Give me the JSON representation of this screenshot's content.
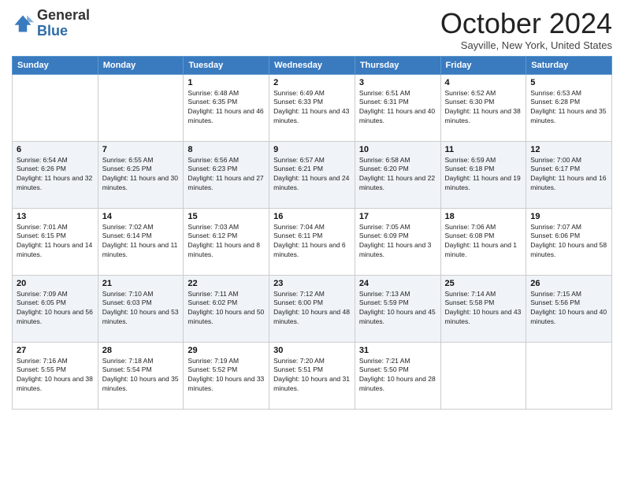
{
  "header": {
    "logo_general": "General",
    "logo_blue": "Blue",
    "month_title": "October 2024",
    "subtitle": "Sayville, New York, United States"
  },
  "days_of_week": [
    "Sunday",
    "Monday",
    "Tuesday",
    "Wednesday",
    "Thursday",
    "Friday",
    "Saturday"
  ],
  "weeks": [
    [
      {
        "day": "",
        "info": ""
      },
      {
        "day": "",
        "info": ""
      },
      {
        "day": "1",
        "info": "Sunrise: 6:48 AM\nSunset: 6:35 PM\nDaylight: 11 hours and 46 minutes."
      },
      {
        "day": "2",
        "info": "Sunrise: 6:49 AM\nSunset: 6:33 PM\nDaylight: 11 hours and 43 minutes."
      },
      {
        "day": "3",
        "info": "Sunrise: 6:51 AM\nSunset: 6:31 PM\nDaylight: 11 hours and 40 minutes."
      },
      {
        "day": "4",
        "info": "Sunrise: 6:52 AM\nSunset: 6:30 PM\nDaylight: 11 hours and 38 minutes."
      },
      {
        "day": "5",
        "info": "Sunrise: 6:53 AM\nSunset: 6:28 PM\nDaylight: 11 hours and 35 minutes."
      }
    ],
    [
      {
        "day": "6",
        "info": "Sunrise: 6:54 AM\nSunset: 6:26 PM\nDaylight: 11 hours and 32 minutes."
      },
      {
        "day": "7",
        "info": "Sunrise: 6:55 AM\nSunset: 6:25 PM\nDaylight: 11 hours and 30 minutes."
      },
      {
        "day": "8",
        "info": "Sunrise: 6:56 AM\nSunset: 6:23 PM\nDaylight: 11 hours and 27 minutes."
      },
      {
        "day": "9",
        "info": "Sunrise: 6:57 AM\nSunset: 6:21 PM\nDaylight: 11 hours and 24 minutes."
      },
      {
        "day": "10",
        "info": "Sunrise: 6:58 AM\nSunset: 6:20 PM\nDaylight: 11 hours and 22 minutes."
      },
      {
        "day": "11",
        "info": "Sunrise: 6:59 AM\nSunset: 6:18 PM\nDaylight: 11 hours and 19 minutes."
      },
      {
        "day": "12",
        "info": "Sunrise: 7:00 AM\nSunset: 6:17 PM\nDaylight: 11 hours and 16 minutes."
      }
    ],
    [
      {
        "day": "13",
        "info": "Sunrise: 7:01 AM\nSunset: 6:15 PM\nDaylight: 11 hours and 14 minutes."
      },
      {
        "day": "14",
        "info": "Sunrise: 7:02 AM\nSunset: 6:14 PM\nDaylight: 11 hours and 11 minutes."
      },
      {
        "day": "15",
        "info": "Sunrise: 7:03 AM\nSunset: 6:12 PM\nDaylight: 11 hours and 8 minutes."
      },
      {
        "day": "16",
        "info": "Sunrise: 7:04 AM\nSunset: 6:11 PM\nDaylight: 11 hours and 6 minutes."
      },
      {
        "day": "17",
        "info": "Sunrise: 7:05 AM\nSunset: 6:09 PM\nDaylight: 11 hours and 3 minutes."
      },
      {
        "day": "18",
        "info": "Sunrise: 7:06 AM\nSunset: 6:08 PM\nDaylight: 11 hours and 1 minute."
      },
      {
        "day": "19",
        "info": "Sunrise: 7:07 AM\nSunset: 6:06 PM\nDaylight: 10 hours and 58 minutes."
      }
    ],
    [
      {
        "day": "20",
        "info": "Sunrise: 7:09 AM\nSunset: 6:05 PM\nDaylight: 10 hours and 56 minutes."
      },
      {
        "day": "21",
        "info": "Sunrise: 7:10 AM\nSunset: 6:03 PM\nDaylight: 10 hours and 53 minutes."
      },
      {
        "day": "22",
        "info": "Sunrise: 7:11 AM\nSunset: 6:02 PM\nDaylight: 10 hours and 50 minutes."
      },
      {
        "day": "23",
        "info": "Sunrise: 7:12 AM\nSunset: 6:00 PM\nDaylight: 10 hours and 48 minutes."
      },
      {
        "day": "24",
        "info": "Sunrise: 7:13 AM\nSunset: 5:59 PM\nDaylight: 10 hours and 45 minutes."
      },
      {
        "day": "25",
        "info": "Sunrise: 7:14 AM\nSunset: 5:58 PM\nDaylight: 10 hours and 43 minutes."
      },
      {
        "day": "26",
        "info": "Sunrise: 7:15 AM\nSunset: 5:56 PM\nDaylight: 10 hours and 40 minutes."
      }
    ],
    [
      {
        "day": "27",
        "info": "Sunrise: 7:16 AM\nSunset: 5:55 PM\nDaylight: 10 hours and 38 minutes."
      },
      {
        "day": "28",
        "info": "Sunrise: 7:18 AM\nSunset: 5:54 PM\nDaylight: 10 hours and 35 minutes."
      },
      {
        "day": "29",
        "info": "Sunrise: 7:19 AM\nSunset: 5:52 PM\nDaylight: 10 hours and 33 minutes."
      },
      {
        "day": "30",
        "info": "Sunrise: 7:20 AM\nSunset: 5:51 PM\nDaylight: 10 hours and 31 minutes."
      },
      {
        "day": "31",
        "info": "Sunrise: 7:21 AM\nSunset: 5:50 PM\nDaylight: 10 hours and 28 minutes."
      },
      {
        "day": "",
        "info": ""
      },
      {
        "day": "",
        "info": ""
      }
    ]
  ]
}
